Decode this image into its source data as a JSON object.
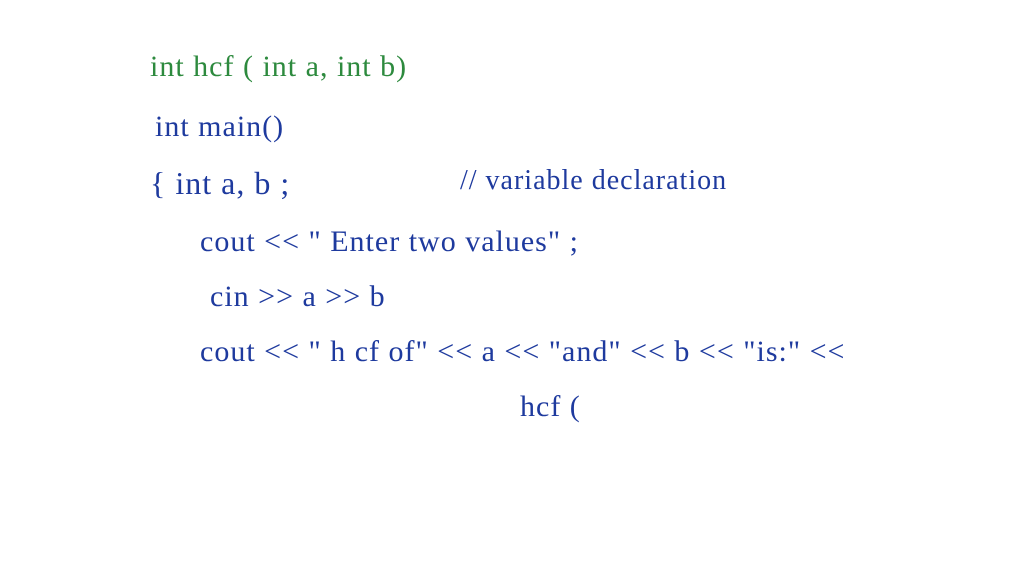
{
  "code": {
    "line1": "int   hcf ( int a, int b)",
    "line2": "int main()",
    "line3_left": "{   int  a, b ;",
    "line3_right": "// variable declaration",
    "line4": "cout << \" Enter two values\" ;",
    "line5": "cin >> a  >> b",
    "line6": "cout << \" h cf of\" << a  << \"and\"  << b << \"is:\" <<",
    "line7": "hcf ("
  }
}
